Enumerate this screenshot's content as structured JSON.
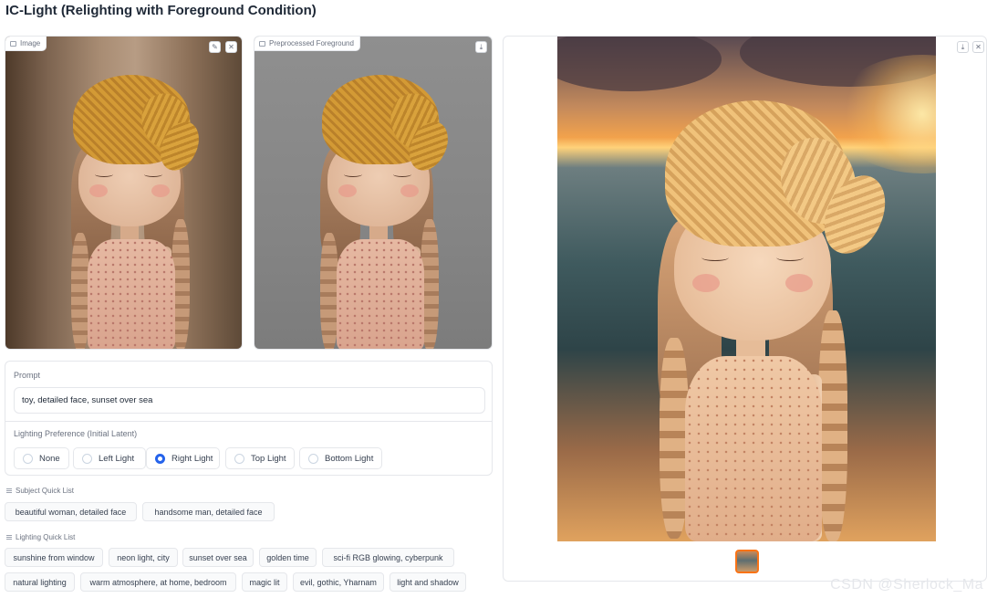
{
  "app": {
    "title": "IC-Light (Relighting with Foreground Condition)"
  },
  "input_panel": {
    "label": "Image",
    "edit_icon": "pencil-icon",
    "close_icon": "close-icon"
  },
  "preprocessed_panel": {
    "label": "Preprocessed Foreground",
    "download_icon": "download-icon"
  },
  "prompt": {
    "label": "Prompt",
    "value": "toy, detailed face, sunset over sea"
  },
  "lighting": {
    "label": "Lighting Preference (Initial Latent)",
    "options": [
      "None",
      "Left Light",
      "Right Light",
      "Top Light",
      "Bottom Light"
    ],
    "selected": "Right Light",
    "accent_color": "#2563eb"
  },
  "subject_quick_list": {
    "label": "Subject Quick List",
    "items": [
      "beautiful woman, detailed face",
      "handsome man, detailed face"
    ]
  },
  "lighting_quick_list": {
    "label": "Lighting Quick List",
    "row1": [
      "sunshine from window",
      "neon light, city",
      "sunset over sea",
      "golden time",
      "sci-fi RGB glowing, cyberpunk"
    ],
    "row2": [
      "natural lighting",
      "warm atmosphere, at home, bedroom",
      "magic lit",
      "evil, gothic, Yharnam",
      "light and shadow"
    ]
  },
  "result_panel": {
    "download_icon": "download-icon",
    "close_icon": "close-icon",
    "thumbnail_selected_color": "#f97316"
  },
  "watermark": "CSDN @Sherlock_Ma"
}
